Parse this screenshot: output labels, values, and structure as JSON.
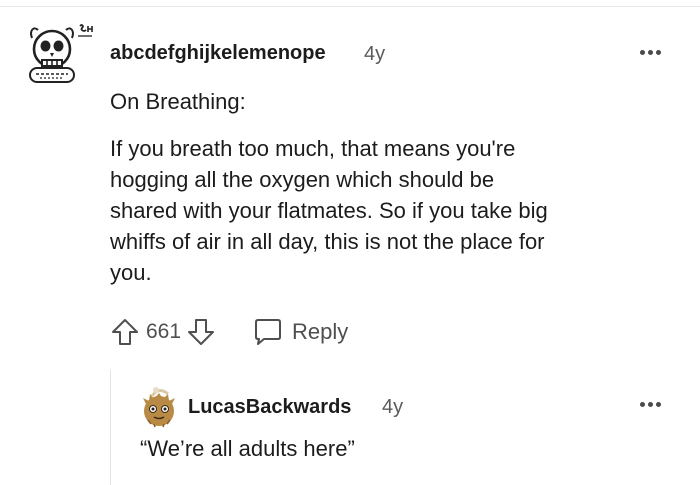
{
  "comment": {
    "username": "abcdefghijkelemenope",
    "age": "4y",
    "title": "On Breathing:",
    "body": "If you breath too much, that means you're\nhogging all the oxygen which should be\nshared with your flatmates. So if you take big\nwhiffs of air in all day, this is not the place for\nyou.",
    "score": "661",
    "reply_label": "Reply",
    "avatar_icon": "skull-avatar-icon",
    "more_icon": "more-options-icon",
    "upvote_icon": "upvote-arrow-icon",
    "downvote_icon": "downvote-arrow-icon",
    "reply_icon": "chat-bubble-icon"
  },
  "reply": {
    "username": "LucasBackwards",
    "age": "4y",
    "body": "“We’re all adults here”",
    "avatar_icon": "furry-creature-avatar-icon",
    "more_icon": "more-options-icon"
  },
  "colors": {
    "text": "#1c1c1c",
    "muted": "#5b5b5b",
    "icon": "#4f4f4f",
    "thread_line": "#e4e4e4"
  }
}
